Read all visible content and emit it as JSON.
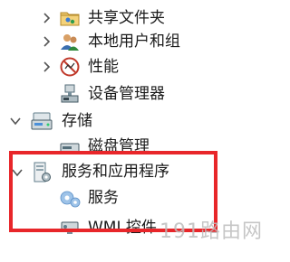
{
  "tree": {
    "items": [
      {
        "label": "共享文件夹",
        "icon": "shared-folder-icon",
        "expander": "collapsed"
      },
      {
        "label": "本地用户和组",
        "icon": "local-users-icon",
        "expander": "collapsed"
      },
      {
        "label": "性能",
        "icon": "performance-icon",
        "expander": "collapsed"
      },
      {
        "label": "设备管理器",
        "icon": "device-manager-icon",
        "expander": "none"
      },
      {
        "label": "存储",
        "icon": "storage-icon",
        "expander": "expanded"
      },
      {
        "label": "磁盘管理",
        "icon": "disk-management-icon",
        "expander": "none"
      },
      {
        "label": "服务和应用程序",
        "icon": "services-apps-icon",
        "expander": "expanded"
      },
      {
        "label": "服务",
        "icon": "services-gear-icon",
        "expander": "none"
      },
      {
        "label": "WMI 控件",
        "icon": "wmi-control-icon",
        "expander": "none"
      }
    ]
  },
  "highlight": {
    "color": "#e8262a"
  },
  "watermark": {
    "text": "191路由网"
  }
}
